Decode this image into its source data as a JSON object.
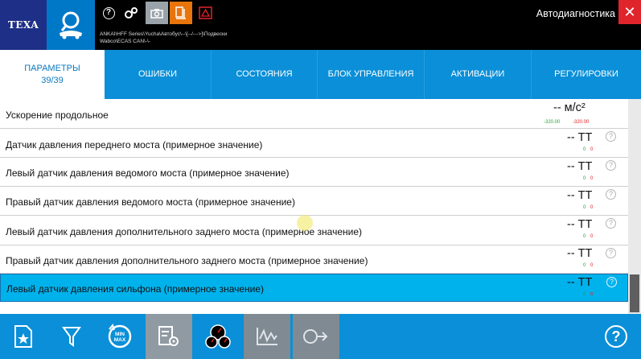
{
  "header": {
    "logo": "TEXA",
    "title": "Автодиагностика",
    "path_line1": "ANKAI\\HFF Series\\Yucha\\Автобус\\--\\[--/--->]\\Подвески",
    "path_line2": "Wabco\\ECAS CAN\\-\\-",
    "help_icon_glyph": "?",
    "close_glyph": "✕"
  },
  "tabs": [
    {
      "label": "ПАРАМЕТРЫ",
      "sub": "39/39",
      "active": true
    },
    {
      "label": "ОШИБКИ"
    },
    {
      "label": "СОСТОЯНИЯ"
    },
    {
      "label": "БЛОК УПРАВЛЕНИЯ"
    },
    {
      "label": "АКТИВАЦИИ"
    },
    {
      "label": "РЕГУЛИРОВКИ"
    }
  ],
  "parameters": [
    {
      "label": "Ускорение продольное",
      "value": "-- м/с²",
      "min": "-320.00",
      "max": "-320.00"
    },
    {
      "label": "Датчик давления переднего моста (примерное значение)",
      "value": "-- ТТ",
      "min": "0",
      "max": "0",
      "info": "?"
    },
    {
      "label": "Левый датчик давления ведомого моста (примерное значение)",
      "value": "-- ТТ",
      "min": "0",
      "max": "0",
      "info": "?"
    },
    {
      "label": "Правый датчик давления ведомого моста (примерное значение)",
      "value": "-- ТТ",
      "min": "0",
      "max": "0",
      "info": "?"
    },
    {
      "label": "Левый датчик давления дополнительного заднего моста (примерное значение)",
      "value": "-- ТТ",
      "min": "0",
      "max": "0",
      "info": "?"
    },
    {
      "label": "Правый датчик давления дополнительного заднего моста (примерное значение)",
      "value": "-- ТТ",
      "min": "0",
      "max": "0",
      "info": "?"
    },
    {
      "label": "Левый датчик давления сильфона (примерное значение)",
      "value": "-- ТТ",
      "min": "0",
      "max": "0",
      "info": "?",
      "selected": true
    }
  ],
  "bottom_toolbar": {
    "minmax_top": "MIN",
    "minmax_bottom": "MAX",
    "help_glyph": "?"
  },
  "colors": {
    "brand_blue": "#0a8fd8",
    "logo_navy": "#1d2f86",
    "selected_row": "#00b2ec",
    "close_red": "#e0242b",
    "min_green": "#27a03c",
    "max_red": "#e02020"
  }
}
